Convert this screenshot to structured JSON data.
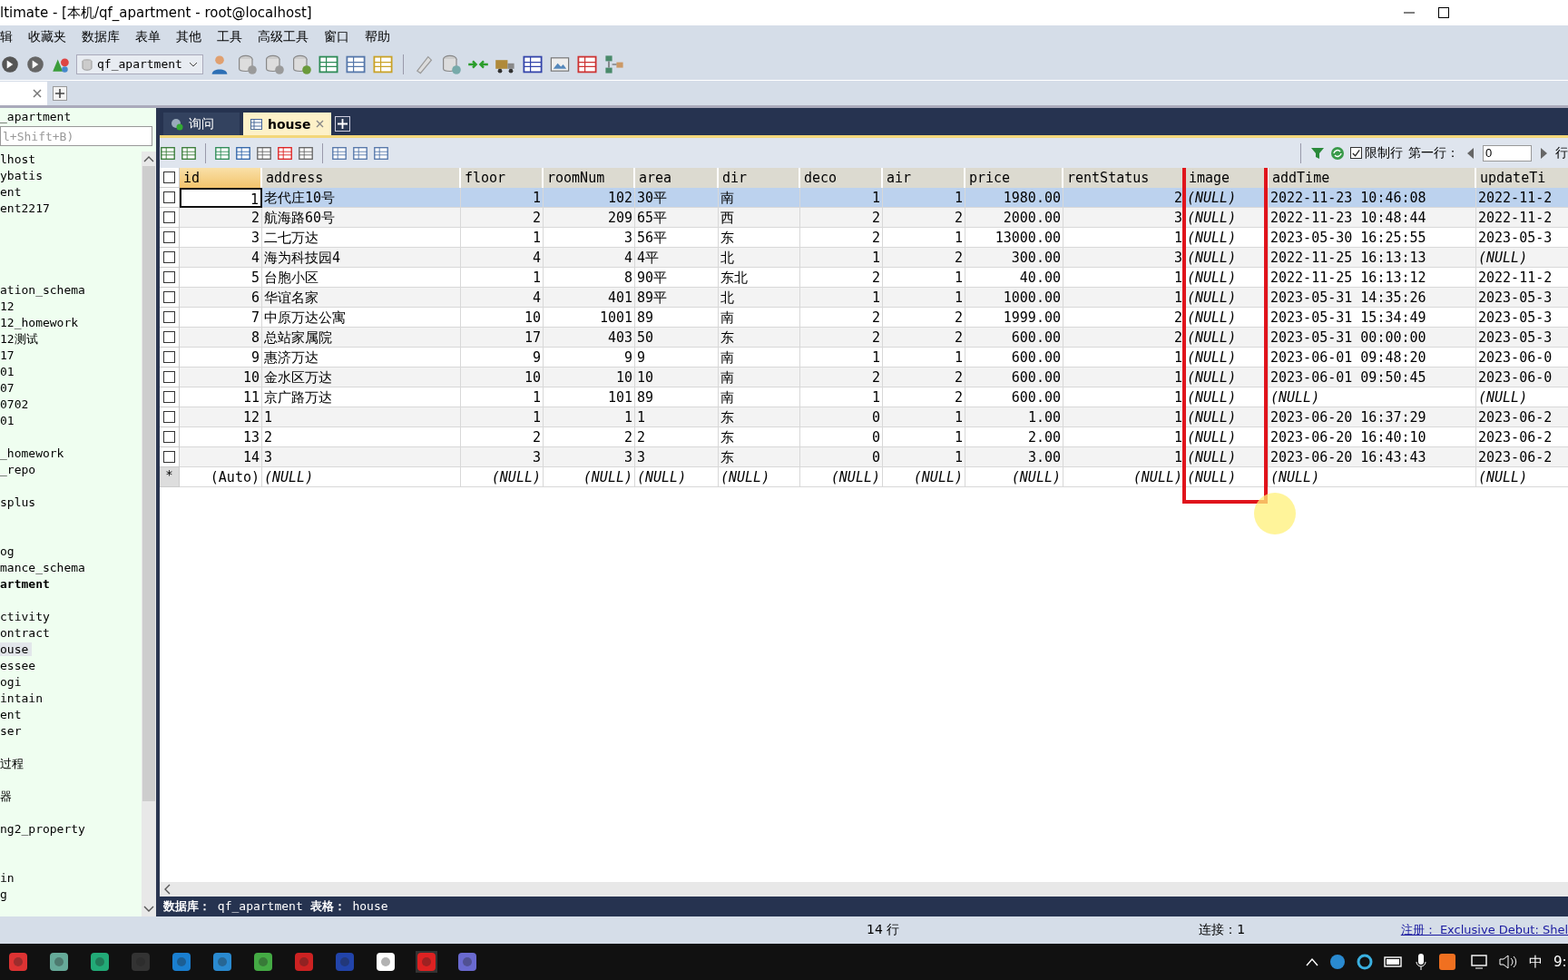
{
  "window": {
    "title": "ltimate - [本机/qf_apartment - root@localhost]"
  },
  "menu": [
    "辑",
    "收藏夹",
    "数据库",
    "表单",
    "其他",
    "工具",
    "高级工具",
    "窗口",
    "帮助"
  ],
  "toolbar": {
    "database_select": "qf_apartment"
  },
  "object_browser": {
    "title": "_apartment",
    "search": {
      "placeholder": "l+Shift+B)"
    },
    "items": [
      {
        "kind": "item",
        "text": "lhost",
        "selected": false
      },
      {
        "kind": "item",
        "text": "ybatis",
        "selected": false
      },
      {
        "kind": "item",
        "text": "ent",
        "selected": false
      },
      {
        "kind": "item",
        "text": "ent2217",
        "selected": false
      },
      {
        "kind": "blank"
      },
      {
        "kind": "blank"
      },
      {
        "kind": "blank"
      },
      {
        "kind": "blank"
      },
      {
        "kind": "item",
        "text": "ation_schema",
        "selected": false
      },
      {
        "kind": "item",
        "text": "12",
        "selected": false
      },
      {
        "kind": "item",
        "text": "12_homework",
        "selected": false
      },
      {
        "kind": "item",
        "text": "12测试",
        "selected": false
      },
      {
        "kind": "item",
        "text": "17",
        "selected": false
      },
      {
        "kind": "item",
        "text": "01",
        "selected": false
      },
      {
        "kind": "item",
        "text": "07",
        "selected": false
      },
      {
        "kind": "item",
        "text": "0702",
        "selected": false
      },
      {
        "kind": "item",
        "text": "01",
        "selected": false
      },
      {
        "kind": "blank"
      },
      {
        "kind": "item",
        "text": "_homework",
        "selected": false
      },
      {
        "kind": "item",
        "text": "_repo",
        "selected": false
      },
      {
        "kind": "blank"
      },
      {
        "kind": "item",
        "text": "splus",
        "selected": false
      },
      {
        "kind": "blank"
      },
      {
        "kind": "blank"
      },
      {
        "kind": "item",
        "text": "og",
        "selected": false
      },
      {
        "kind": "item",
        "text": "mance_schema",
        "selected": false
      },
      {
        "kind": "current",
        "text": "artment",
        "selected": false
      },
      {
        "kind": "blank"
      },
      {
        "kind": "item",
        "text": "ctivity",
        "selected": false
      },
      {
        "kind": "item",
        "text": "ontract",
        "selected": false
      },
      {
        "kind": "item",
        "text": "ouse",
        "selected": true
      },
      {
        "kind": "item",
        "text": "essee",
        "selected": false
      },
      {
        "kind": "item",
        "text": "ogi",
        "selected": false
      },
      {
        "kind": "item",
        "text": "intain",
        "selected": false
      },
      {
        "kind": "item",
        "text": "ent",
        "selected": false
      },
      {
        "kind": "item",
        "text": "ser",
        "selected": false
      },
      {
        "kind": "blank"
      },
      {
        "kind": "item",
        "text": "过程",
        "selected": false
      },
      {
        "kind": "blank"
      },
      {
        "kind": "item",
        "text": "器",
        "selected": false
      },
      {
        "kind": "blank"
      },
      {
        "kind": "item",
        "text": "ng2_property",
        "selected": false
      },
      {
        "kind": "blank"
      },
      {
        "kind": "blank"
      },
      {
        "kind": "item",
        "text": "in",
        "selected": false
      },
      {
        "kind": "item",
        "text": "g",
        "selected": false
      }
    ]
  },
  "tabs": [
    {
      "label": "询问",
      "selected": false
    },
    {
      "label": "house",
      "selected": true
    }
  ],
  "grid_toolbar": {
    "limit_rows": {
      "label": "限制行",
      "checked": true
    },
    "first_row": {
      "label": "第一行：",
      "value": "0"
    },
    "trailing": "行"
  },
  "table": {
    "select_all": {
      "checked": false
    },
    "columns": [
      {
        "name": "id",
        "kind": "number",
        "selected": true,
        "marked": false
      },
      {
        "name": "address",
        "kind": "text",
        "selected": false,
        "marked": false
      },
      {
        "name": "floor",
        "kind": "number",
        "selected": false,
        "marked": false
      },
      {
        "name": "roomNum",
        "kind": "number",
        "selected": false,
        "marked": false
      },
      {
        "name": "area",
        "kind": "text",
        "selected": false,
        "marked": false
      },
      {
        "name": "dir",
        "kind": "text",
        "selected": false,
        "marked": false
      },
      {
        "name": "deco",
        "kind": "number",
        "selected": false,
        "marked": false
      },
      {
        "name": "air",
        "kind": "number",
        "selected": false,
        "marked": false
      },
      {
        "name": "price",
        "kind": "number",
        "selected": false,
        "marked": false
      },
      {
        "name": "rentStatus",
        "kind": "number",
        "selected": false,
        "marked": false
      },
      {
        "name": "image",
        "kind": "text",
        "selected": false,
        "marked": true
      },
      {
        "name": "addTime",
        "kind": "text",
        "selected": false,
        "marked": false
      },
      {
        "name": "updateTi",
        "kind": "text",
        "selected": false,
        "marked": false
      }
    ],
    "rows": [
      {
        "kind": "row",
        "selected": true,
        "checked": false,
        "cells": [
          "1",
          "老代庄10号",
          "1",
          "102",
          "30平",
          "南",
          "1",
          "1",
          "1980.00",
          "2",
          {
            "kind": "null",
            "text": "(NULL)"
          },
          "2022-11-23 10:46:08",
          "2022-11-2"
        ]
      },
      {
        "kind": "row",
        "selected": false,
        "checked": false,
        "cells": [
          "2",
          "航海路60号",
          "2",
          "209",
          "65平",
          "西",
          "2",
          "2",
          "2000.00",
          "3",
          {
            "kind": "null",
            "text": "(NULL)"
          },
          "2022-11-23 10:48:44",
          "2022-11-2"
        ]
      },
      {
        "kind": "row",
        "selected": false,
        "checked": false,
        "cells": [
          "3",
          "二七万达",
          "1",
          "3",
          "56平",
          "东",
          "2",
          "1",
          "13000.00",
          "1",
          {
            "kind": "null",
            "text": "(NULL)"
          },
          "2023-05-30 16:25:55",
          "2023-05-3"
        ]
      },
      {
        "kind": "row",
        "selected": false,
        "checked": false,
        "cells": [
          "4",
          "海为科技园4",
          "4",
          "4",
          "4平",
          "北",
          "1",
          "2",
          "300.00",
          "3",
          {
            "kind": "null",
            "text": "(NULL)"
          },
          "2022-11-25 16:13:13",
          {
            "kind": "null",
            "text": "(NULL)"
          }
        ]
      },
      {
        "kind": "row",
        "selected": false,
        "checked": false,
        "cells": [
          "5",
          "台胞小区",
          "1",
          "8",
          "90平",
          "东北",
          "2",
          "1",
          "40.00",
          "1",
          {
            "kind": "null",
            "text": "(NULL)"
          },
          "2022-11-25 16:13:12",
          "2022-11-2"
        ]
      },
      {
        "kind": "row",
        "selected": false,
        "checked": false,
        "cells": [
          "6",
          "华谊名家",
          "4",
          "401",
          "89平",
          "北",
          "1",
          "1",
          "1000.00",
          "1",
          {
            "kind": "null",
            "text": "(NULL)"
          },
          "2023-05-31 14:35:26",
          "2023-05-3"
        ]
      },
      {
        "kind": "row",
        "selected": false,
        "checked": false,
        "cells": [
          "7",
          "中原万达公寓",
          "10",
          "1001",
          "89",
          "南",
          "2",
          "2",
          "1999.00",
          "2",
          {
            "kind": "null",
            "text": "(NULL)"
          },
          "2023-05-31 15:34:49",
          "2023-05-3"
        ]
      },
      {
        "kind": "row",
        "selected": false,
        "checked": false,
        "cells": [
          "8",
          "总站家属院",
          "17",
          "403",
          "50",
          "东",
          "2",
          "2",
          "600.00",
          "2",
          {
            "kind": "null",
            "text": "(NULL)"
          },
          "2023-05-31 00:00:00",
          "2023-05-3"
        ]
      },
      {
        "kind": "row",
        "selected": false,
        "checked": false,
        "cells": [
          "9",
          "惠济万达",
          "9",
          "9",
          "9",
          "南",
          "1",
          "1",
          "600.00",
          "1",
          {
            "kind": "null",
            "text": "(NULL)"
          },
          "2023-06-01 09:48:20",
          "2023-06-0"
        ]
      },
      {
        "kind": "row",
        "selected": false,
        "checked": false,
        "cells": [
          "10",
          "金水区万达",
          "10",
          "10",
          "10",
          "南",
          "2",
          "2",
          "600.00",
          "1",
          {
            "kind": "null",
            "text": "(NULL)"
          },
          "2023-06-01 09:50:45",
          "2023-06-0"
        ]
      },
      {
        "kind": "row",
        "selected": false,
        "checked": false,
        "cells": [
          "11",
          "京广路万达",
          "1",
          "101",
          "89",
          "南",
          "1",
          "2",
          "600.00",
          "1",
          {
            "kind": "null",
            "text": "(NULL)"
          },
          {
            "kind": "null",
            "text": "(NULL)"
          },
          {
            "kind": "null",
            "text": "(NULL)"
          }
        ]
      },
      {
        "kind": "row",
        "selected": false,
        "checked": false,
        "cells": [
          "12",
          "1",
          "1",
          "1",
          "1",
          "东",
          "0",
          "1",
          "1.00",
          "1",
          {
            "kind": "null",
            "text": "(NULL)"
          },
          "2023-06-20 16:37:29",
          "2023-06-2"
        ]
      },
      {
        "kind": "row",
        "selected": false,
        "checked": false,
        "cells": [
          "13",
          "2",
          "2",
          "2",
          "2",
          "东",
          "0",
          "1",
          "2.00",
          "1",
          {
            "kind": "null",
            "text": "(NULL)"
          },
          "2023-06-20 16:40:10",
          "2023-06-2"
        ]
      },
      {
        "kind": "row",
        "selected": false,
        "checked": false,
        "cells": [
          "14",
          "3",
          "3",
          "3",
          "3",
          "东",
          "0",
          "1",
          "3.00",
          "1",
          {
            "kind": "null",
            "text": "(NULL)"
          },
          "2023-06-20 16:43:43",
          "2023-06-2"
        ]
      },
      {
        "kind": "new",
        "marker": "*",
        "cells": [
          "(Auto)",
          {
            "kind": "null",
            "text": "(NULL)"
          },
          {
            "kind": "null",
            "text": "(NULL)"
          },
          {
            "kind": "null",
            "text": "(NULL)"
          },
          {
            "kind": "null",
            "text": "(NULL)"
          },
          {
            "kind": "null",
            "text": "(NULL)"
          },
          {
            "kind": "null",
            "text": "(NULL)"
          },
          {
            "kind": "null",
            "text": "(NULL)"
          },
          {
            "kind": "null",
            "text": "(NULL)"
          },
          {
            "kind": "null",
            "text": "(NULL)"
          },
          {
            "kind": "null",
            "text": "(NULL)"
          },
          {
            "kind": "null",
            "text": "(NULL)"
          },
          {
            "kind": "null",
            "text": "(NULL)"
          }
        ]
      }
    ]
  },
  "table_info": "**数据库：** qf_apartment **表格：** house",
  "status_bar": {
    "rows": "14 行",
    "connection": "连接：1",
    "link": "注册： Exclusive Debut: Shel"
  },
  "taskbar": {
    "ime": "中",
    "clock": "9:"
  }
}
